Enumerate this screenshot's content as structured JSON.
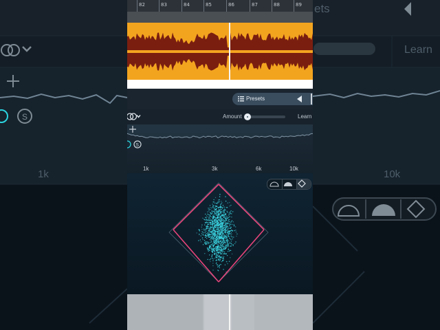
{
  "ruler": {
    "labels": [
      "82",
      "83",
      "84",
      "85",
      "86",
      "87",
      "88",
      "89"
    ]
  },
  "presets": {
    "label": "Presets"
  },
  "amount": {
    "label": "Amount",
    "value": 0.05
  },
  "learn": {
    "label": "Learn"
  },
  "eq": {
    "freq_labels": [
      "1k",
      "3k",
      "6k",
      "10k"
    ]
  },
  "background": {
    "presets_partial": "ets",
    "learn_label": "Learn",
    "freq_left": "1k",
    "freq_right": "10k"
  },
  "colors": {
    "waveform_bg": "#f3a41f",
    "waveform_fg": "#7a1e10",
    "scatter": "#3fe3f0",
    "diamond": "#e8457b",
    "accent": "#2bd5e0"
  },
  "icons": {
    "stereo": "stereo-link-icon",
    "chevron": "chevron-down-icon",
    "plus": "plus-icon",
    "solo": "solo-icon",
    "list": "list-icon",
    "arrow": "triangle-left-icon",
    "mode_half": "semicircle-scope-icon",
    "mode_half_filled": "semicircle-filled-icon",
    "mode_diamond": "diamond-mode-icon"
  }
}
